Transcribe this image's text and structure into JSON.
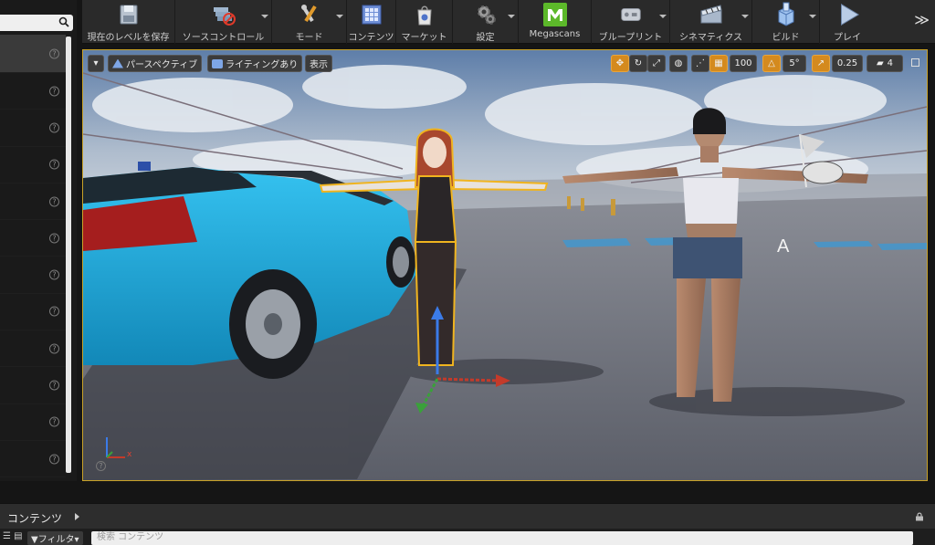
{
  "toolbar": {
    "buttons": [
      {
        "label": "現在のレベルを保存",
        "icon": "save-icon"
      },
      {
        "label": "ソースコントロール",
        "icon": "source-control-icon"
      },
      {
        "label": "モード",
        "icon": "modes-icon"
      },
      {
        "label": "コンテンツ",
        "icon": "content-icon"
      },
      {
        "label": "マーケット",
        "icon": "marketplace-icon"
      },
      {
        "label": "設定",
        "icon": "settings-icon"
      },
      {
        "label": "Megascans",
        "icon": "megascans-icon"
      },
      {
        "label": "ブループリント",
        "icon": "blueprint-icon"
      },
      {
        "label": "シネマティクス",
        "icon": "cinematics-icon"
      },
      {
        "label": "ビルド",
        "icon": "build-icon"
      },
      {
        "label": "プレイ",
        "icon": "play-icon"
      }
    ],
    "more_symbol": "≫"
  },
  "viewport": {
    "menu_symbol": "▾",
    "perspective_label": "パースペクティブ",
    "lighting_label": "ライティングあり",
    "show_label": "表示",
    "grid_snap_value": "100",
    "rotation_snap_value": "5°",
    "scale_snap_value": "0.25",
    "camera_speed_value": "4",
    "gizmo_label": "A",
    "axis_x_label": "x"
  },
  "left_panel": {
    "row_count": 12,
    "help_symbol": "?"
  },
  "content_browser": {
    "title": "コンテンツ",
    "filter_label": "▼フィルタ▾",
    "search_placeholder": "検索 コンテンツ"
  },
  "colors": {
    "accent": "#d48a1e",
    "selection": "#c9a227",
    "megascans": "#5cb82a"
  }
}
